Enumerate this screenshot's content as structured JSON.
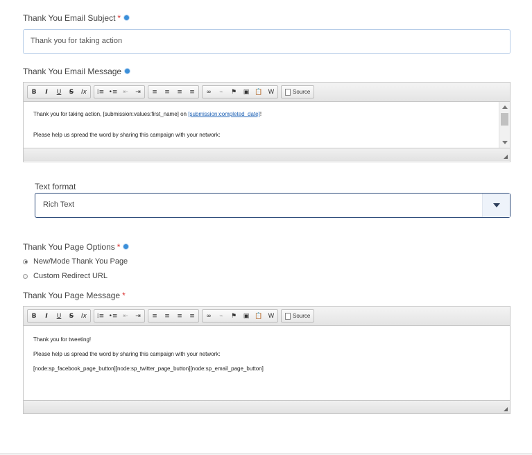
{
  "subject": {
    "label": "Thank You Email Subject",
    "required": "*",
    "value": "Thank you for taking action"
  },
  "email_message": {
    "label": "Thank You Email Message",
    "line1_prefix": "Thank you for taking action, [submission:values:first_name] on ",
    "line1_link": "[submission:completed_date]",
    "line1_suffix": "!",
    "line2": "Please help us spread the word by sharing this campaign with your network:"
  },
  "toolbar": {
    "bold": "B",
    "italic": "I",
    "underline": "U",
    "strike": "S",
    "clear": "Ix",
    "ol": "⁞≡",
    "ul": "•≡",
    "outdent": "⇤",
    "indent": "⇥",
    "align_left": "≡",
    "align_center": "≡",
    "align_right": "≡",
    "justify": "≡",
    "link": "∞",
    "unlink": "⌁",
    "anchor": "⚑",
    "image": "▣",
    "paste": "📋",
    "paste_word": "W",
    "source_label": "Source"
  },
  "text_format": {
    "label": "Text format",
    "value": "Rich Text"
  },
  "page_options": {
    "label": "Thank You Page Options",
    "required": "*",
    "option1": "New/Mode Thank You Page",
    "option2": "Custom Redirect URL"
  },
  "page_message": {
    "label": "Thank You Page Message",
    "required": "*",
    "line1": "Thank you for tweeting!",
    "line2": "Please help us spread the word by sharing this campaign with your network:",
    "line3": "[node:sp_facebook_page_button][node:sp_twitter_page_button][node:sp_email_page_button]"
  },
  "colors": {
    "required": "#d9302f",
    "info": "#3b8fd9",
    "link": "#1a5fb4",
    "select_border": "#2d4b7a"
  }
}
